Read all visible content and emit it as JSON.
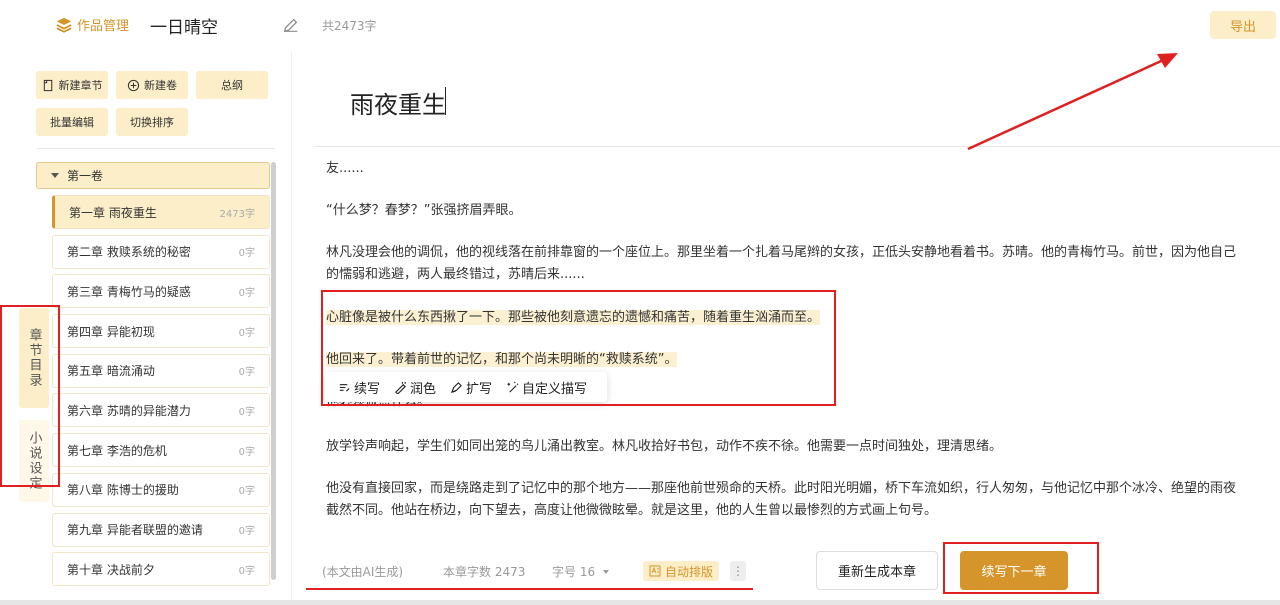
{
  "header": {
    "brand": "作品管理",
    "work_title": "一日晴空",
    "word_count": "共2473字",
    "export": "导出"
  },
  "sidebar": {
    "tools": [
      "新建章节",
      "新建卷",
      "总纲",
      "批量编辑",
      "切换排序"
    ],
    "vertical_tabs": [
      "章节目录",
      "小说设定"
    ],
    "volume": "第一卷",
    "chapters": [
      {
        "title": "第一章 雨夜重生",
        "count": "2473字"
      },
      {
        "title": "第二章 救赎系统的秘密",
        "count": "0字"
      },
      {
        "title": "第三章 青梅竹马的疑惑",
        "count": "0字"
      },
      {
        "title": "第四章 异能初现",
        "count": "0字"
      },
      {
        "title": "第五章 暗流涌动",
        "count": "0字"
      },
      {
        "title": "第六章 苏晴的异能潜力",
        "count": "0字"
      },
      {
        "title": "第七章 李浩的危机",
        "count": "0字"
      },
      {
        "title": "第八章 陈博士的援助",
        "count": "0字"
      },
      {
        "title": "第九章 异能者联盟的邀请",
        "count": "0字"
      },
      {
        "title": "第十章 决战前夕",
        "count": "0字"
      }
    ]
  },
  "editor": {
    "title": "雨夜重生",
    "paragraphs": {
      "p0": "友......",
      "p1": "“什么梦？春梦？”张强挤眉弄眼。",
      "p2a": "林凡没理会他的调侃，他的视线落在前排靠窗的一个座位上。那里坐着一个扎着马尾辫的女孩，正低头安静地看着书。苏晴。他的青梅竹马。前世，因为他自己",
      "p2b": "的懦弱和逃避，两人最终错过，苏晴后来......",
      "p3": "心脏像是被什么东西揪了一下。那些被他刻意遗忘的遗憾和痛苦，随着重生汹涌而至。",
      "p4": "他回来了。带着前世的记忆，和那个尚未明晰的“救赎系统”。",
      "p5": "他必须做点什么。",
      "p6": "放学铃声响起，学生们如同出笼的鸟儿涌出教室。林凡收拾好书包，动作不疾不徐。他需要一点时间独处，理清思绪。",
      "p7a": "他没有直接回家，而是绕路走到了记忆中的那个地方——那座他前世殒命的天桥。此时阳光明媚，桥下车流如织，行人匆匆，与他记忆中那个冰冷、绝望的雨夜",
      "p7b": "截然不同。他站在桥边，向下望去，高度让他微微眩晕。就是这里，他的人生曾以最惨烈的方式画上句号。"
    },
    "popup": [
      "续写",
      "润色",
      "扩写",
      "自定义描写"
    ]
  },
  "footer": {
    "ai_note": "(本文由AI生成)",
    "chapter_count": "本章字数 2473",
    "font_size": "字号 16",
    "auto_layout": "自动排版",
    "more": "⋮",
    "regenerate": "重新生成本章",
    "next": "续写下一章"
  },
  "colors": {
    "accent": "#d6952b",
    "accent_light": "#fbeec8",
    "annotation": "#e02020"
  }
}
